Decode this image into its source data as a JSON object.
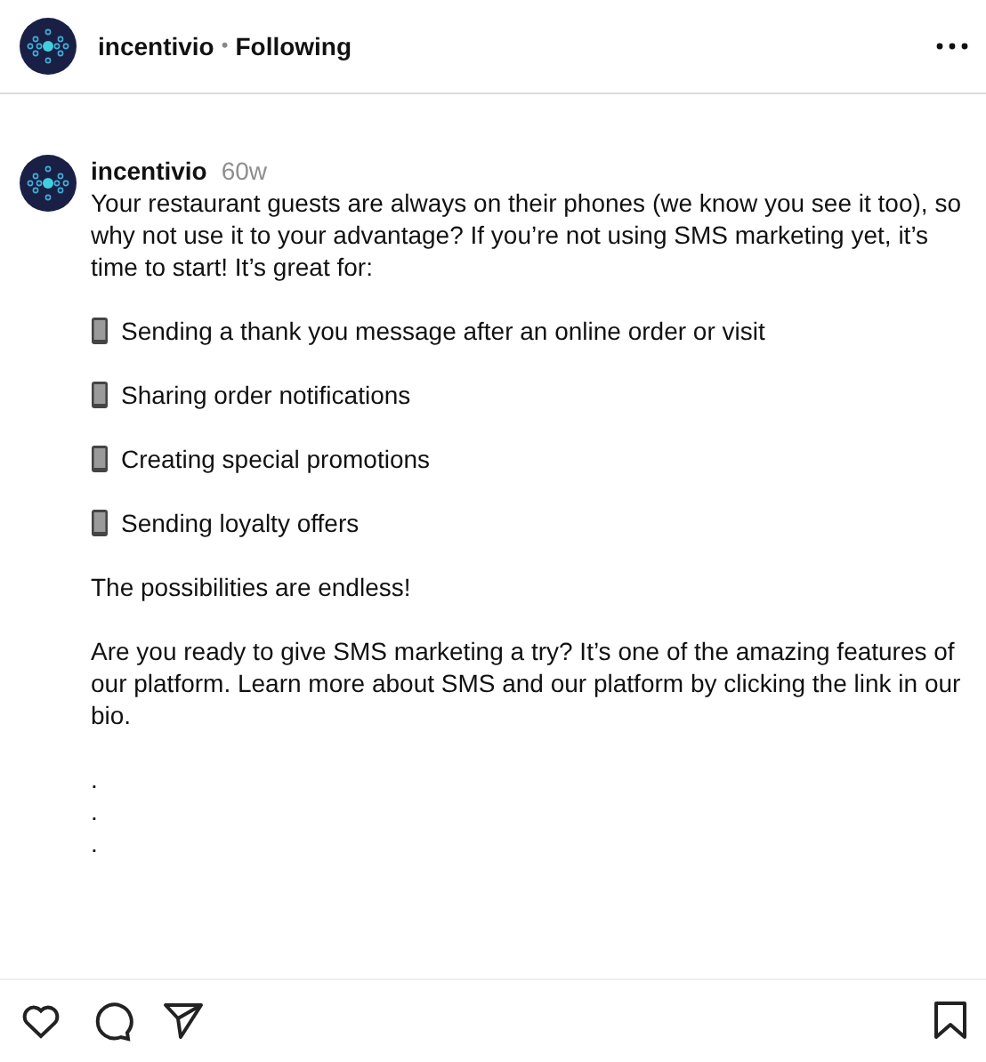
{
  "header": {
    "username": "incentivio",
    "separator": "•",
    "follow_status": "Following"
  },
  "caption": {
    "username": "incentivio",
    "time": "60w",
    "blocks": [
      {
        "kind": "text",
        "text": "Your restaurant guests are always on their phones (we know you see it too), so why not use it to your advantage? If you’re not using SMS marketing yet, it’s time to start! It’s great for:"
      },
      {
        "kind": "bullet",
        "text": "Sending a thank you message after an online order or visit"
      },
      {
        "kind": "bullet",
        "text": "Sharing order notifications"
      },
      {
        "kind": "bullet",
        "text": "Creating special promotions"
      },
      {
        "kind": "bullet",
        "text": "Sending loyalty offers"
      },
      {
        "kind": "text",
        "text": "The possibilities are endless!"
      },
      {
        "kind": "text",
        "text": "Are you ready to give SMS marketing a try? It’s one of the amazing features of our platform. Learn more about SMS and our platform by clicking the link in our bio."
      },
      {
        "kind": "text",
        "text": ".\n.\n."
      }
    ]
  }
}
